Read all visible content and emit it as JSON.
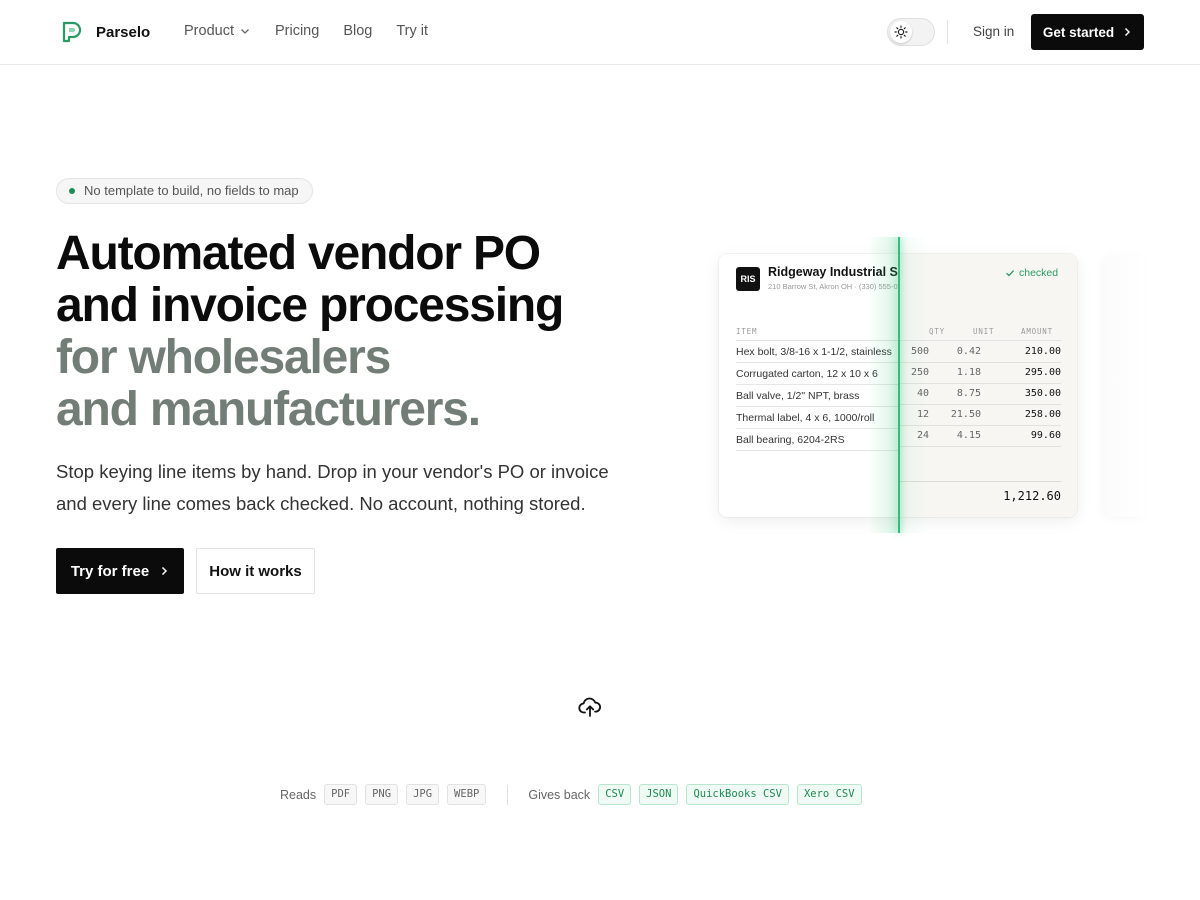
{
  "nav": {
    "brand": "Parselo",
    "links": [
      {
        "label": "Product",
        "has_dropdown": true
      },
      {
        "label": "Pricing"
      },
      {
        "label": "Blog"
      },
      {
        "label": "Try it"
      }
    ],
    "sign_in": "Sign in",
    "get_started": "Get started"
  },
  "hero": {
    "pill": "No template to build, no fields to map",
    "title_lines": [
      "Automated vendor PO",
      "and invoice processing"
    ],
    "title_muted_lines": [
      "for wholesalers",
      "and manufacturers."
    ],
    "subtitle": "Stop keying line items by hand. Drop in your vendor's PO or invoice and every line comes back checked. No account, nothing stored.",
    "primary_cta": "Try for free",
    "secondary_cta": "How it works"
  },
  "document": {
    "vendor_initials": "RIS",
    "vendor_name": "Ridgeway Industrial Supply",
    "vendor_address": "210 Barrow St, Akron OH · (330) 555-0142",
    "status": "checked",
    "columns": {
      "item": "ITEM",
      "qty": "QTY",
      "unit": "UNIT",
      "amount": "AMOUNT"
    },
    "rows": [
      {
        "item": "Hex bolt, 3/8-16 x 1-1/2, stainless",
        "qty": "500",
        "unit": "0.42",
        "amount": "210.00"
      },
      {
        "item": "Corrugated carton, 12 x 10 x 6",
        "qty": "250",
        "unit": "1.18",
        "amount": "295.00"
      },
      {
        "item": "Ball valve, 1/2\" NPT, brass",
        "qty": "40",
        "unit": "8.75",
        "amount": "350.00"
      },
      {
        "item": "Thermal label, 4 x 6, 1000/roll",
        "qty": "12",
        "unit": "21.50",
        "amount": "258.00"
      },
      {
        "item": "Ball bearing, 6204-2RS",
        "qty": "24",
        "unit": "4.15",
        "amount": "99.60"
      }
    ],
    "total": "1,212.60"
  },
  "formats": {
    "reads_label": "Reads",
    "reads": [
      "PDF",
      "PNG",
      "JPG",
      "WEBP"
    ],
    "gives_label": "Gives back",
    "gives": [
      "CSV",
      "JSON",
      "QuickBooks CSV",
      "Xero CSV"
    ]
  },
  "icons": {
    "brand_mark": "parselo-logo-icon",
    "theme": "sun-icon",
    "upload": "cloud-upload-icon"
  },
  "colors": {
    "accent_green": "#2fbf7a",
    "muted_heading": "#727d78",
    "primary_button": "#0b0b0b"
  }
}
